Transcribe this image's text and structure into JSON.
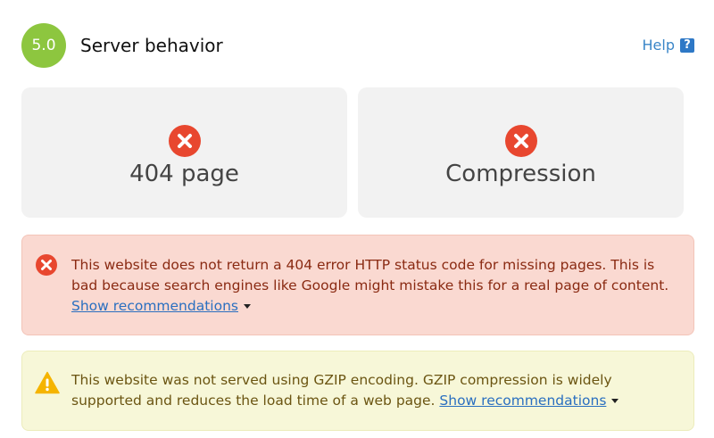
{
  "header": {
    "score": "5.0",
    "title": "Server behavior",
    "help_label": "Help",
    "help_icon": "question-mark-icon"
  },
  "colors": {
    "score_badge": "#8dc63f",
    "fail_icon": "#e8472f",
    "card_bg": "#f2f2f2",
    "error_bg": "#fad9d1",
    "warning_bg": "#f7f7d8",
    "link": "#2a6fc0",
    "help_link": "#3a86c8"
  },
  "cards": [
    {
      "label": "404 page",
      "status": "fail",
      "icon": "x-circle-icon"
    },
    {
      "label": "Compression",
      "status": "fail",
      "icon": "x-circle-icon"
    }
  ],
  "alerts": {
    "error": {
      "icon": "x-circle-icon",
      "text": "This website does not return a 404 error HTTP status code for missing pages. This is bad because search engines like Google might mistake this for a real page of content.",
      "link_label": "Show recommendations"
    },
    "warning": {
      "icon": "warning-triangle-icon",
      "text": "This website was not served using GZIP encoding. GZIP compression is widely supported and reduces the load time of a web page.",
      "link_label": "Show recommendations"
    }
  }
}
